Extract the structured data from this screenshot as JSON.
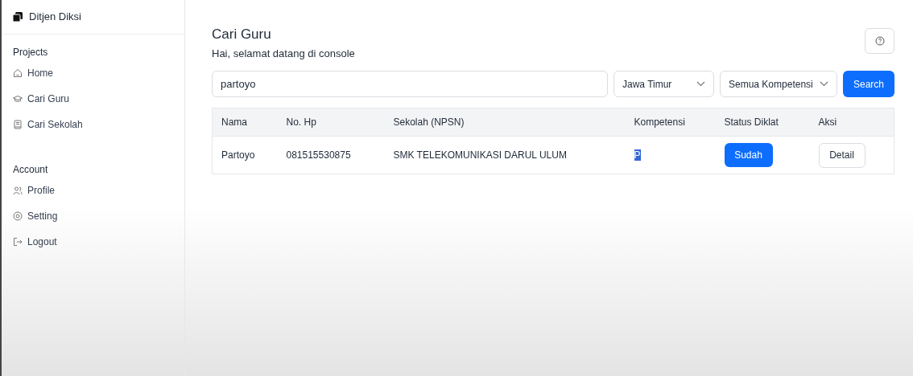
{
  "sidebar": {
    "brand": "Ditjen Diksi",
    "sections": [
      {
        "title": "Projects",
        "items": [
          {
            "label": "Home",
            "kind": "home"
          },
          {
            "label": "Cari Guru",
            "kind": "cap"
          },
          {
            "label": "Cari Sekolah",
            "kind": "book"
          }
        ]
      },
      {
        "title": "Account",
        "items": [
          {
            "label": "Profile",
            "kind": "users"
          },
          {
            "label": "Setting",
            "kind": "gear"
          },
          {
            "label": "Logout",
            "kind": "logout"
          }
        ]
      }
    ]
  },
  "header": {
    "title": "Cari Guru",
    "subtitle": "Hai, selamat datang di console"
  },
  "search": {
    "value": "partoyo",
    "province": "Jawa Timur",
    "competency": "Semua Kompetensi",
    "button": "Search"
  },
  "table": {
    "columns": [
      "Nama",
      "No. Hp",
      "Sekolah (NPSN)",
      "Kompetensi",
      "Status Diklat",
      "Aksi"
    ],
    "rows": [
      {
        "nama": "Partoyo",
        "hp": "081515530875",
        "sekolah": "SMK TELEKOMUNIKASI DARUL ULUM",
        "kompetensi": "P",
        "kompetensi_highlighted": true,
        "status": "Sudah",
        "aksi": "Detail"
      }
    ]
  }
}
